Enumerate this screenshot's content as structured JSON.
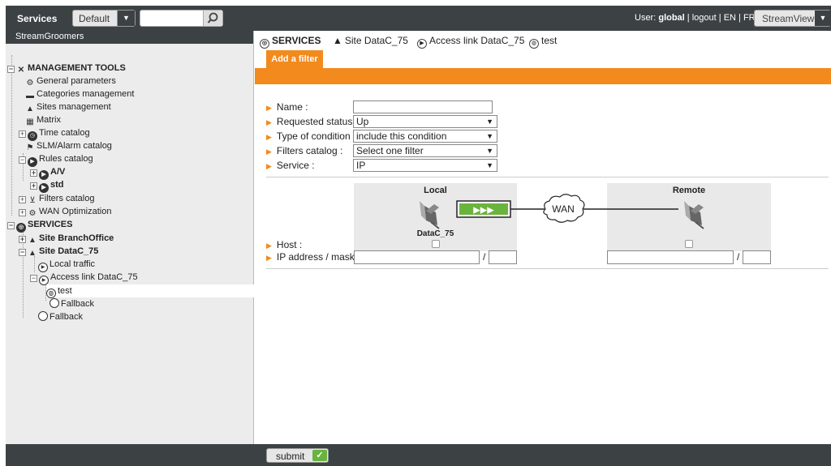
{
  "topbar": {
    "services_label": "Services",
    "profile_select": "Default",
    "search_placeholder": "",
    "user_prefix": "User:",
    "user_name": "global",
    "logout": "logout",
    "lang_en": "EN",
    "lang_fr": "FR",
    "view_select": "StreamView"
  },
  "sidebar": {
    "org_name": "StreamGroomers",
    "tree": [
      {
        "label": "MANAGEMENT TOOLS",
        "icon": "tools-icon"
      },
      {
        "label": "General parameters",
        "icon": "gears-icon"
      },
      {
        "label": "Categories management",
        "icon": "folder-icon"
      },
      {
        "label": "Sites management",
        "icon": "house-icon"
      },
      {
        "label": "Matrix",
        "icon": "grid-icon"
      },
      {
        "label": "Time catalog",
        "icon": "clock-icon"
      },
      {
        "label": "SLM/Alarm catalog",
        "icon": "flag-icon"
      },
      {
        "label": "Rules catalog",
        "icon": "play-icon"
      },
      {
        "label": "A/V",
        "icon": "play-icon"
      },
      {
        "label": "std",
        "icon": "play-icon"
      },
      {
        "label": "Filters catalog",
        "icon": "filter-icon"
      },
      {
        "label": "WAN Optimization",
        "icon": "gears-icon"
      },
      {
        "label": "SERVICES",
        "icon": "globe-icon"
      },
      {
        "label": "Site BranchOffice",
        "icon": "house-icon"
      },
      {
        "label": "Site DataC_75",
        "icon": "house-icon"
      },
      {
        "label": "Local traffic",
        "icon": "play-outline-icon"
      },
      {
        "label": "Access link DataC_75",
        "icon": "play-outline-icon"
      },
      {
        "label": "test",
        "icon": "globe-small-icon"
      },
      {
        "label": "Fallback",
        "icon": "circle-icon"
      },
      {
        "label": "Fallback",
        "icon": "circle-icon"
      }
    ]
  },
  "breadcrumb": {
    "services": "SERVICES",
    "site": "Site DataC_75",
    "access_link": "Access link DataC_75",
    "test": "test"
  },
  "tab": {
    "add_filter": "Add a filter"
  },
  "form": {
    "name_label": "Name :",
    "name_value": "",
    "requested_status_label": "Requested status :",
    "requested_status_value": "Up",
    "condition_label": "Type of condition :",
    "condition_value": "include this condition",
    "filters_catalog_label": "Filters catalog :",
    "filters_catalog_value": "Select one filter",
    "service_label": "Service :",
    "service_value": "IP",
    "host_label": "Host :",
    "ip_mask_label": "IP address / mask :",
    "slash": "/"
  },
  "diagram": {
    "local_title": "Local",
    "local_site": "DataC_75",
    "remote_title": "Remote",
    "wan_label": "WAN",
    "arrows": "▶▶▶"
  },
  "footer": {
    "submit_label": "submit"
  },
  "colors": {
    "accent": "#f28a1d",
    "bar": "#3c4144",
    "ok": "#6ab43e"
  }
}
